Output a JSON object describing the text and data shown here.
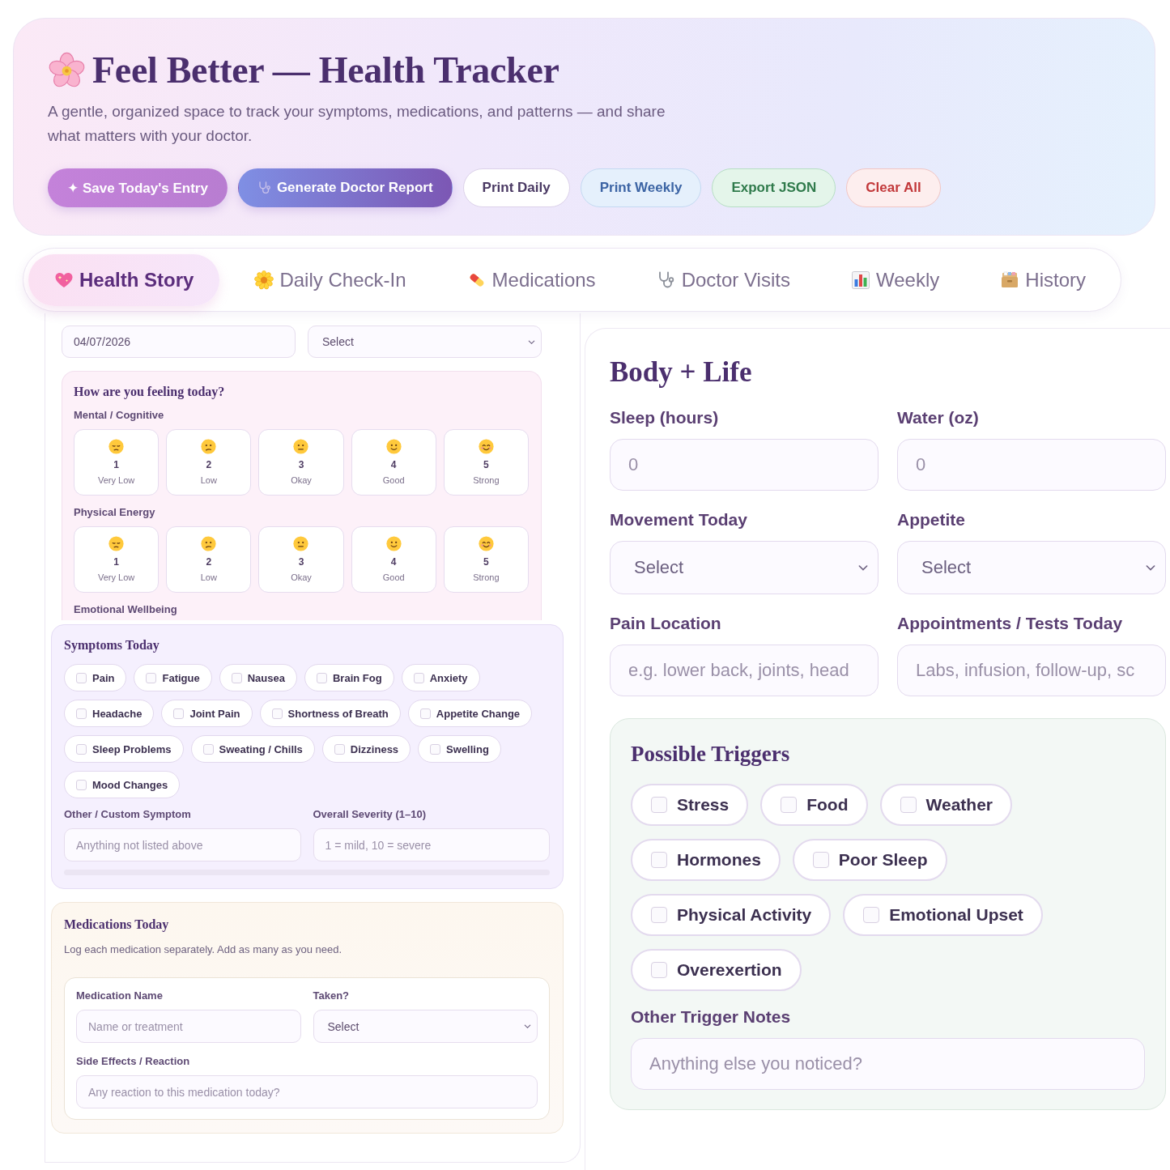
{
  "header": {
    "title": "Feel Better — Health Tracker",
    "subtitle": "A gentle, organized space to track your symptoms, medications, and patterns — and share what matters with your doctor.",
    "buttons": [
      {
        "label": "✦ Save Today's Entry",
        "kind": "primary"
      },
      {
        "label": "Generate Doctor Report",
        "kind": "report"
      },
      {
        "label": "Print Daily",
        "kind": "plain"
      },
      {
        "label": "Print Weekly",
        "kind": "info"
      },
      {
        "label": "Export JSON",
        "kind": "success"
      },
      {
        "label": "Clear All",
        "kind": "danger"
      }
    ]
  },
  "tabs": [
    {
      "label": "Health Story",
      "selected": true
    },
    {
      "label": "Daily Check-In",
      "selected": false
    },
    {
      "label": "Medications",
      "selected": false
    },
    {
      "label": "Doctor Visits",
      "selected": false
    },
    {
      "label": "Weekly",
      "selected": false
    },
    {
      "label": "History",
      "selected": false
    }
  ],
  "entry": {
    "date": {
      "value": "04/07/2026"
    },
    "stage": {
      "value": "Select"
    }
  },
  "feelings": {
    "title": "How are you feeling today?",
    "scales": [
      {
        "label": "Mental / Cognitive",
        "options": [
          {
            "number": "1",
            "label": "Very Low",
            "selected": false
          },
          {
            "number": "2",
            "label": "Low",
            "selected": false
          },
          {
            "number": "3",
            "label": "Okay",
            "selected": false
          },
          {
            "number": "4",
            "label": "Good",
            "selected": false
          },
          {
            "number": "5",
            "label": "Strong",
            "selected": false
          }
        ]
      },
      {
        "label": "Physical Energy",
        "options": [
          {
            "number": "1",
            "label": "Very Low",
            "selected": false
          },
          {
            "number": "2",
            "label": "Low",
            "selected": false
          },
          {
            "number": "3",
            "label": "Okay",
            "selected": false
          },
          {
            "number": "4",
            "label": "Good",
            "selected": false
          },
          {
            "number": "5",
            "label": "Strong",
            "selected": false
          }
        ]
      }
    ],
    "next_label": "Emotional Wellbeing"
  },
  "symptoms": {
    "title": "Symptoms Today",
    "options": [
      {
        "label": "Pain",
        "checked": false
      },
      {
        "label": "Fatigue",
        "checked": false
      },
      {
        "label": "Nausea",
        "checked": false
      },
      {
        "label": "Brain Fog",
        "checked": false
      },
      {
        "label": "Anxiety",
        "checked": false
      },
      {
        "label": "Headache",
        "checked": false
      },
      {
        "label": "Joint Pain",
        "checked": false
      },
      {
        "label": "Shortness of Breath",
        "checked": false
      },
      {
        "label": "Appetite Change",
        "checked": false
      },
      {
        "label": "Sleep Problems",
        "checked": false
      },
      {
        "label": "Sweating / Chills",
        "checked": false
      },
      {
        "label": "Dizziness",
        "checked": false
      },
      {
        "label": "Swelling",
        "checked": false
      },
      {
        "label": "Mood Changes",
        "checked": false
      }
    ],
    "fields": [
      {
        "label": "Other / Custom Symptom",
        "placeholder": "Anything not listed above"
      },
      {
        "label": "Overall Severity (1–10)",
        "placeholder": "1 = mild, 10 = severe"
      }
    ]
  },
  "medications": {
    "title": "Medications Today",
    "note": "Log each medication separately. Add as many as you need.",
    "entry": {
      "name": {
        "label": "Medication Name",
        "placeholder": "Name or treatment"
      },
      "taken": {
        "label": "Taken?",
        "value": "Select"
      },
      "side_effects": {
        "label": "Side Effects / Reaction",
        "placeholder": "Any reaction to this medication today?"
      }
    }
  },
  "body_life": {
    "title": "Body + Life",
    "fields": [
      {
        "label": "Sleep (hours)",
        "kind": "input",
        "placeholder": "0"
      },
      {
        "label": "Water (oz)",
        "kind": "input",
        "placeholder": "0"
      },
      {
        "label": "Movement Today",
        "kind": "select",
        "value": "Select"
      },
      {
        "label": "Appetite",
        "kind": "select",
        "value": "Select"
      },
      {
        "label": "Pain Location",
        "kind": "input",
        "placeholder": "e.g. lower back, joints, head"
      },
      {
        "label": "Appointments / Tests Today",
        "kind": "input",
        "placeholder": "Labs, infusion, follow-up, sc"
      }
    ]
  },
  "triggers": {
    "title": "Possible Triggers",
    "options": [
      {
        "label": "Stress",
        "checked": false
      },
      {
        "label": "Food",
        "checked": false
      },
      {
        "label": "Weather",
        "checked": false
      },
      {
        "label": "Hormones",
        "checked": false
      },
      {
        "label": "Poor Sleep",
        "checked": false
      },
      {
        "label": "Physical Activity",
        "checked": false
      },
      {
        "label": "Emotional Upset",
        "checked": false
      },
      {
        "label": "Overexertion",
        "checked": false
      }
    ],
    "notes": {
      "label": "Other Trigger Notes",
      "placeholder": "Anything else you noticed?"
    }
  }
}
